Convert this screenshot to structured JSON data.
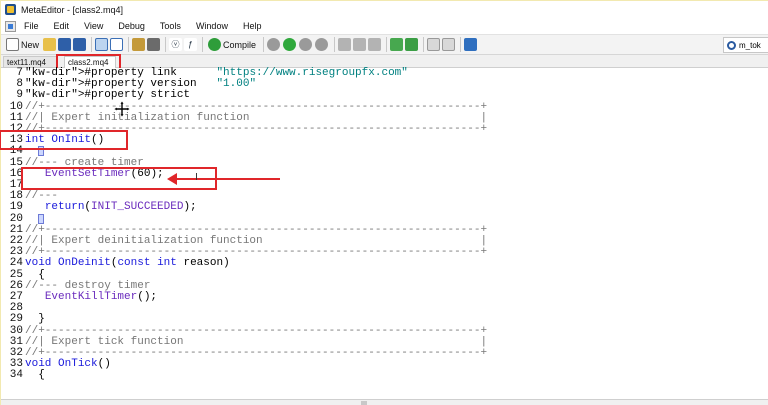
{
  "window": {
    "title": "MetaEditor - [class2.mq4]"
  },
  "menu": [
    "File",
    "Edit",
    "View",
    "Debug",
    "Tools",
    "Window",
    "Help"
  ],
  "toolbar": {
    "new_label": "New",
    "compile_label": "Compile",
    "search_value": "m_tok"
  },
  "tabs": [
    {
      "label": "text11.mq4",
      "active": false
    },
    {
      "label": "class2.mq4",
      "active": true
    }
  ],
  "colors": {
    "highlight": "#e0262a",
    "keyword": "#1a1adb",
    "directive": "#6a2bbd",
    "string": "#008080",
    "comment": "#777777"
  },
  "code": [
    {
      "n": "7",
      "t": "#property link      \"https://www.risegroupfx.com\""
    },
    {
      "n": "8",
      "t": "#property version   \"1.00\""
    },
    {
      "n": "9",
      "t": "#property strict"
    },
    {
      "n": "10",
      "t": "//+------------------------------------------------------------------+"
    },
    {
      "n": "11",
      "t": "//| Expert initialization function                                   |"
    },
    {
      "n": "12",
      "t": "//+------------------------------------------------------------------+"
    },
    {
      "n": "13",
      "t": "int OnInit()"
    },
    {
      "n": "14",
      "t": "  {"
    },
    {
      "n": "15",
      "t": "//--- create timer"
    },
    {
      "n": "16",
      "t": "   EventSetTimer(60);"
    },
    {
      "n": "17",
      "t": ""
    },
    {
      "n": "18",
      "t": "//---"
    },
    {
      "n": "19",
      "t": "   return(INIT_SUCCEEDED);"
    },
    {
      "n": "20",
      "t": "  }"
    },
    {
      "n": "21",
      "t": "//+------------------------------------------------------------------+"
    },
    {
      "n": "22",
      "t": "//| Expert deinitialization function                                 |"
    },
    {
      "n": "23",
      "t": "//+------------------------------------------------------------------+"
    },
    {
      "n": "24",
      "t": "void OnDeinit(const int reason)"
    },
    {
      "n": "25",
      "t": "  {"
    },
    {
      "n": "26",
      "t": "//--- destroy timer"
    },
    {
      "n": "27",
      "t": "   EventKillTimer();"
    },
    {
      "n": "28",
      "t": ""
    },
    {
      "n": "29",
      "t": "  }"
    },
    {
      "n": "30",
      "t": "//+------------------------------------------------------------------+"
    },
    {
      "n": "31",
      "t": "//| Expert tick function                                             |"
    },
    {
      "n": "32",
      "t": "//+------------------------------------------------------------------+"
    },
    {
      "n": "33",
      "t": "void OnTick()"
    },
    {
      "n": "34",
      "t": "  {"
    }
  ]
}
